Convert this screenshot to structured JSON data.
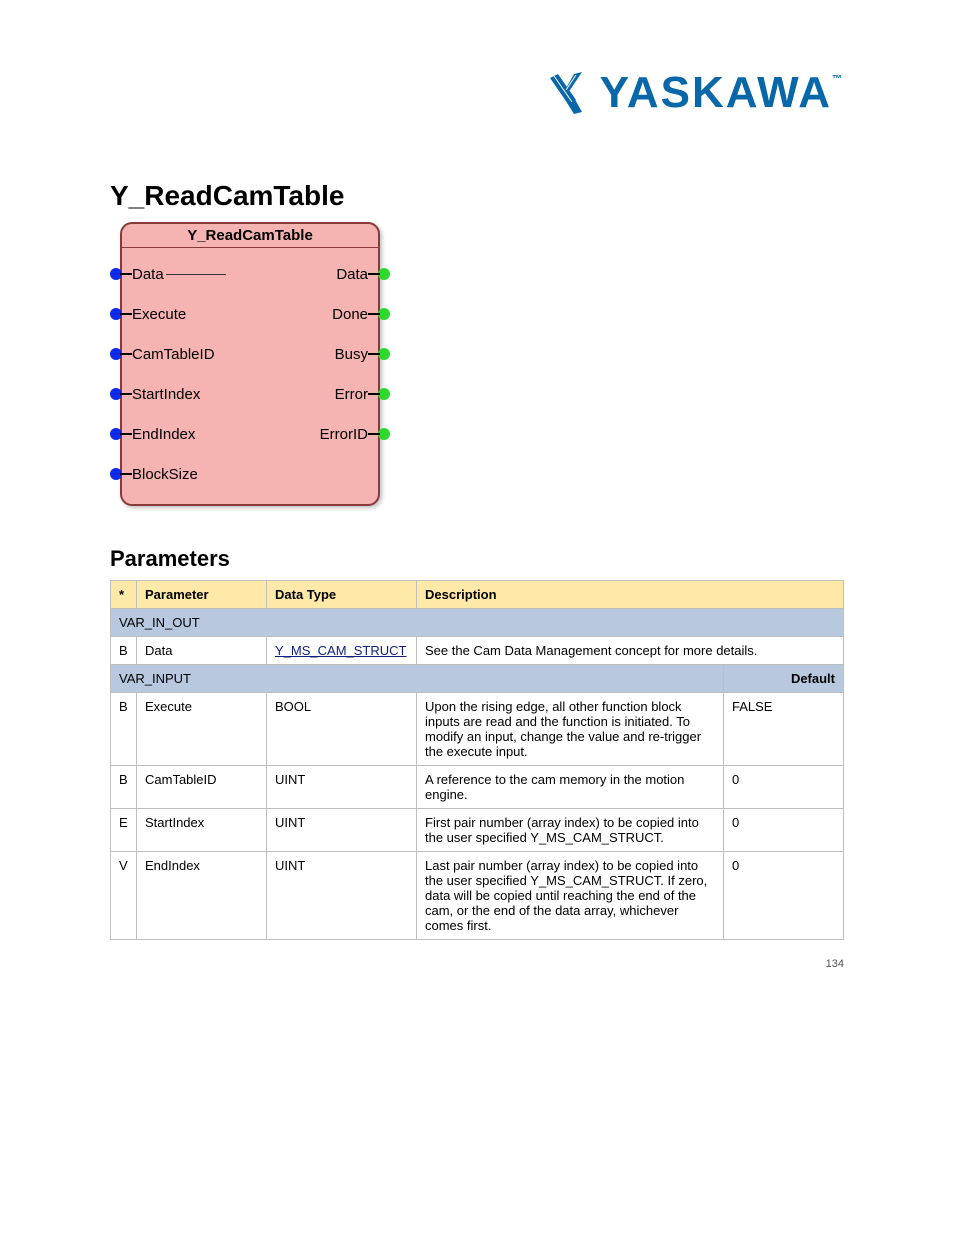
{
  "brand": {
    "name": "YASKAWA",
    "trademark": "™"
  },
  "title": "Y_ReadCamTable",
  "block": {
    "title": "Y_ReadCamTable",
    "left_ports": [
      "Data",
      "Execute",
      "CamTableID",
      "StartIndex",
      "EndIndex",
      "BlockSize"
    ],
    "right_ports": [
      "Data",
      "Done",
      "Busy",
      "Error",
      "ErrorID"
    ]
  },
  "params_heading": "Parameters",
  "table": {
    "headers": [
      "*",
      "Parameter",
      "Data Type",
      "Description"
    ],
    "section_var": "VAR_IN_OUT",
    "section_var_in": "VAR_INPUT",
    "default_header": "Default",
    "rows_var": [
      {
        "flag": "B",
        "param": "Data",
        "type": "Y_MS_CAM_STRUCT",
        "type_link": true,
        "desc": "See the Cam Data Management concept for more details."
      }
    ],
    "rows_in": [
      {
        "flag": "B",
        "param": "Execute",
        "type": "BOOL",
        "desc": "Upon the rising edge, all other function block inputs are read and the function is initiated. To modify an input, change the value and re-trigger the execute input.",
        "default": "FALSE"
      },
      {
        "flag": "B",
        "param": "CamTableID",
        "type": "UINT",
        "desc": "A reference to the cam memory in the motion engine.",
        "default": "0"
      },
      {
        "flag": "E",
        "param": "StartIndex",
        "type": "UINT",
        "desc": "First pair number (array index) to be copied into the user specified Y_MS_CAM_STRUCT.",
        "default": "0"
      },
      {
        "flag": "V",
        "param": "EndIndex",
        "type": "UINT",
        "desc": "Last pair number (array index) to be copied into the user specified Y_MS_CAM_STRUCT. If zero, data will be copied until reaching the end of the cam, or the end of the data array, whichever comes first.",
        "default": "0"
      }
    ]
  },
  "page_number": "134"
}
